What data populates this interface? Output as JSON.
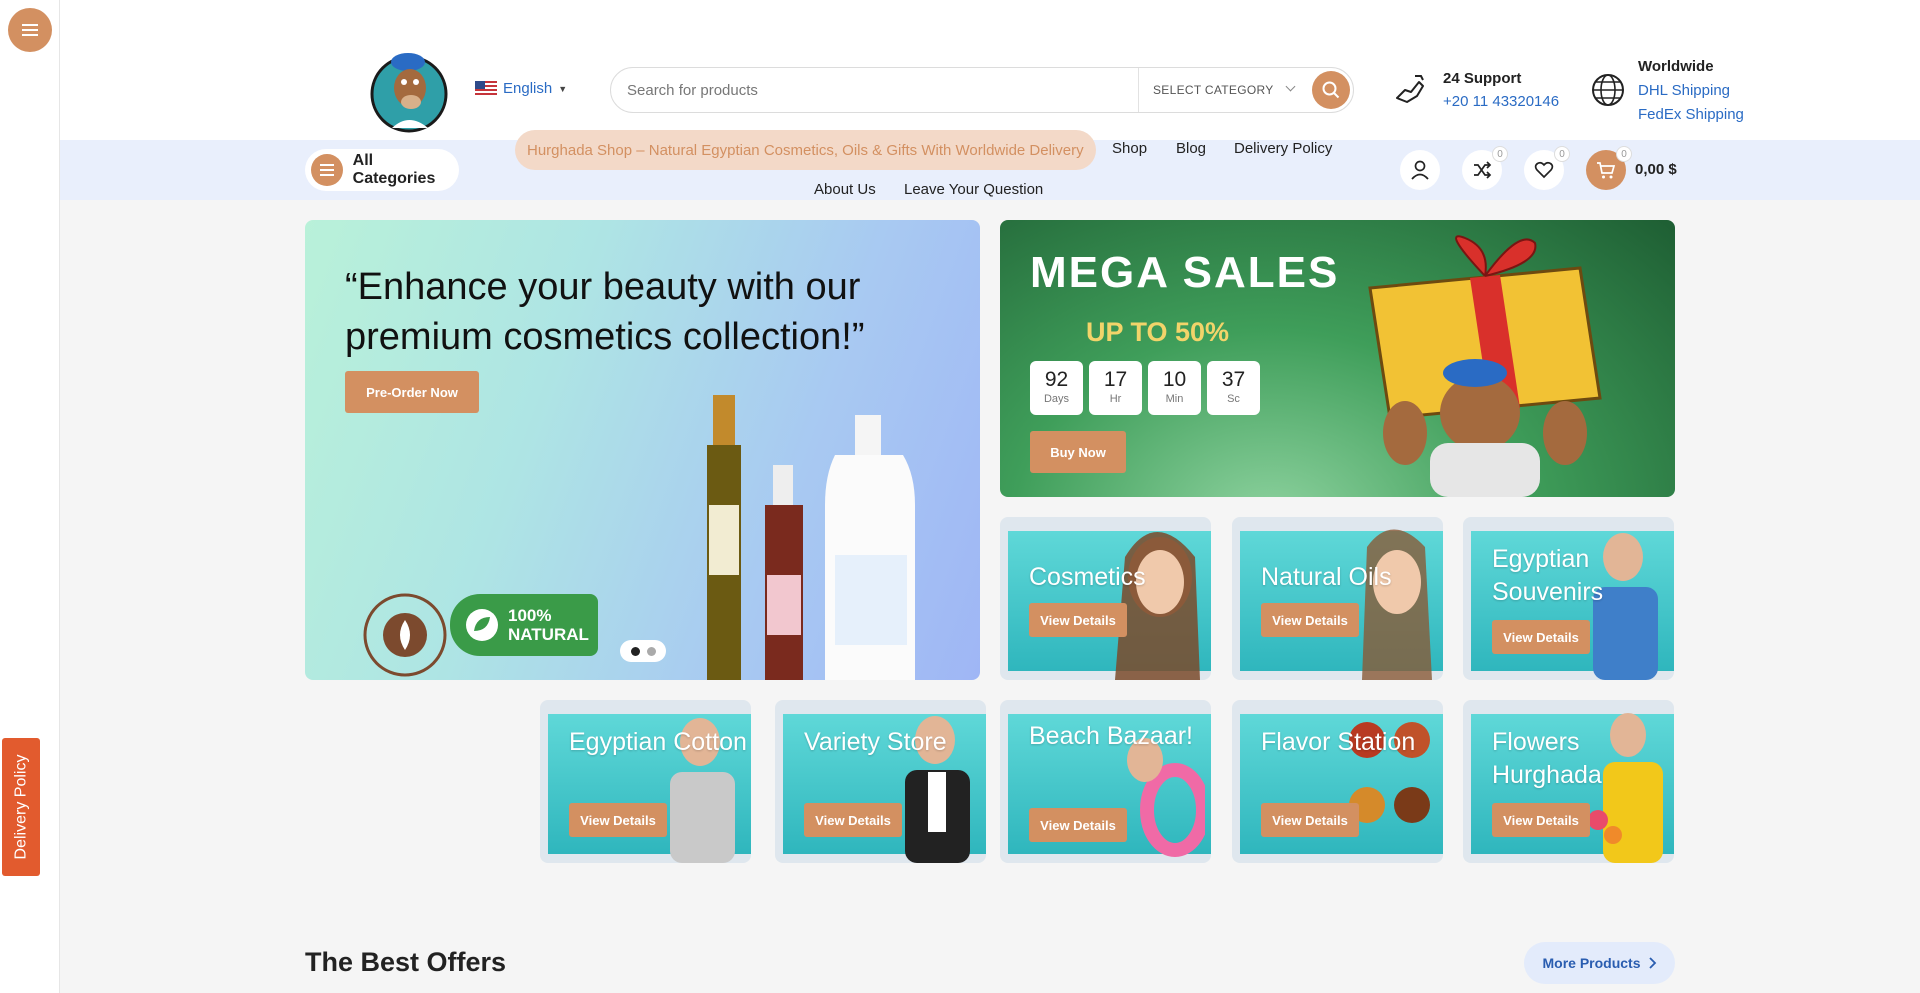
{
  "header": {
    "logo_alt": "Hurghada Shop logo",
    "language": "English",
    "search": {
      "placeholder": "Search for products",
      "category": "SELECT CATEGORY"
    },
    "support": {
      "title": "24 Support",
      "phone": "+20 11 43320146"
    },
    "worldwide": {
      "title": "Worldwide",
      "link1": "DHL Shipping",
      "link2": "FedEx Shipping"
    }
  },
  "nav": {
    "all_categories": "All Categories",
    "items": [
      "Hurghada Shop – Natural Egyptian Cosmetics, Oils & Gifts With Worldwide Delivery",
      "Shop",
      "Blog",
      "Delivery Policy",
      "About Us",
      "Leave Your Question"
    ],
    "compare_count": "0",
    "wishlist_count": "0",
    "cart_count": "0",
    "cart_total": "0,00 $"
  },
  "hero": {
    "title": "“Enhance your beauty with our premium cosmetics collection!”",
    "cta": "Pre-Order Now",
    "badge_text": "100% NATURAL",
    "slides": 2,
    "active_slide": 1
  },
  "promo": {
    "title": "MEGA SALES",
    "subtitle": "UP TO 50%",
    "countdown": [
      {
        "value": "92",
        "unit": "Days"
      },
      {
        "value": "17",
        "unit": "Hr"
      },
      {
        "value": "10",
        "unit": "Min"
      },
      {
        "value": "37",
        "unit": "Sc"
      }
    ],
    "cta": "Buy Now"
  },
  "categories": [
    {
      "name": "Cosmetics",
      "cta": "View Details"
    },
    {
      "name": "Natural Oils",
      "cta": "View Details"
    },
    {
      "name": "Egyptian Souvenirs",
      "cta": "View Details"
    },
    {
      "name": "Egyptian Cotton",
      "cta": "View Details"
    },
    {
      "name": "Variety Store",
      "cta": "View Details"
    },
    {
      "name": "Beach Bazaar!",
      "cta": "View Details"
    },
    {
      "name": "Flavor Station",
      "cta": "View Details"
    },
    {
      "name": "Flowers Hurghada",
      "cta": "View Details"
    }
  ],
  "best_offers": {
    "title": "The Best Offers",
    "more": "More Products"
  },
  "side_tab": "Delivery Policy",
  "colors": {
    "accent": "#d39061",
    "nav_bg": "#e9effc",
    "link": "#2a6bc4",
    "tab": "#e25b2e"
  }
}
